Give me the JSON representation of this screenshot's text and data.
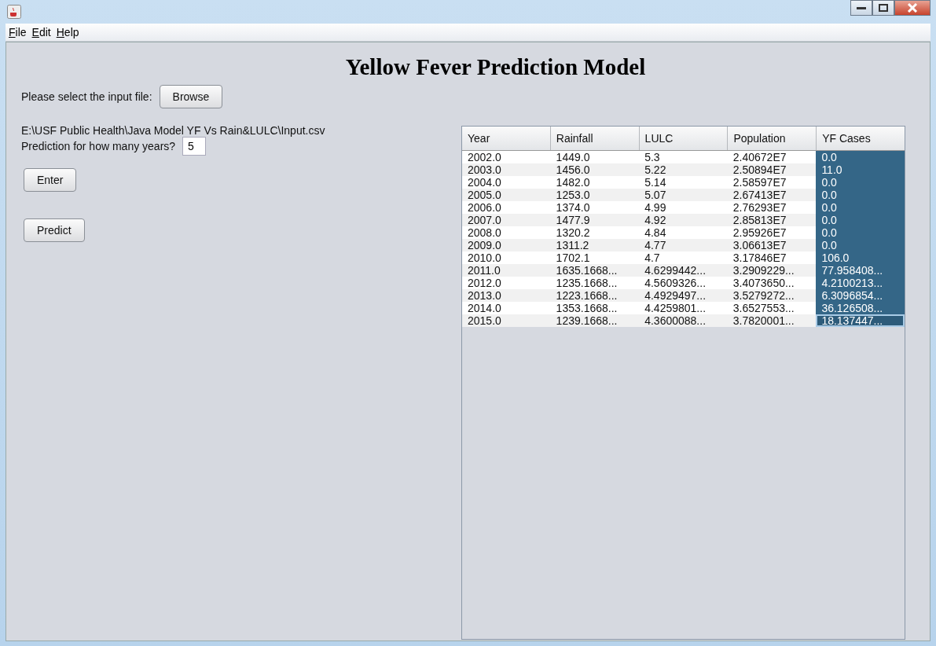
{
  "menu": [
    "File",
    "Edit",
    "Help"
  ],
  "title": "Yellow Fever Prediction Model",
  "file_prompt": "Please select the input file:",
  "browse_button": "Browse",
  "file_path": "E:\\USF Public Health\\Java Model YF Vs Rain&LULC\\Input.csv",
  "years_prompt": "Prediction for how many years?",
  "years_field": {
    "value": "5"
  },
  "buttons": [
    "Enter",
    "Predict"
  ],
  "table": {
    "columns": [
      {
        "label": "Year",
        "selected": false
      },
      {
        "label": "Rainfall",
        "selected": false
      },
      {
        "label": "LULC",
        "selected": false
      },
      {
        "label": "Population",
        "selected": false
      },
      {
        "label": "YF Cases",
        "selected": true
      }
    ],
    "rows": [
      {
        "cells": [
          "2002.0",
          "1449.0",
          "5.3",
          "2.40672E7",
          "0.0"
        ],
        "focused": false
      },
      {
        "cells": [
          "2003.0",
          "1456.0",
          "5.22",
          "2.50894E7",
          "11.0"
        ],
        "focused": false
      },
      {
        "cells": [
          "2004.0",
          "1482.0",
          "5.14",
          "2.58597E7",
          "0.0"
        ],
        "focused": false
      },
      {
        "cells": [
          "2005.0",
          "1253.0",
          "5.07",
          "2.67413E7",
          "0.0"
        ],
        "focused": false
      },
      {
        "cells": [
          "2006.0",
          "1374.0",
          "4.99",
          "2.76293E7",
          "0.0"
        ],
        "focused": false
      },
      {
        "cells": [
          "2007.0",
          "1477.9",
          "4.92",
          "2.85813E7",
          "0.0"
        ],
        "focused": false
      },
      {
        "cells": [
          "2008.0",
          "1320.2",
          "4.84",
          "2.95926E7",
          "0.0"
        ],
        "focused": false
      },
      {
        "cells": [
          "2009.0",
          "1311.2",
          "4.77",
          "3.06613E7",
          "0.0"
        ],
        "focused": false
      },
      {
        "cells": [
          "2010.0",
          "1702.1",
          "4.7",
          "3.17846E7",
          "106.0"
        ],
        "focused": false
      },
      {
        "cells": [
          "2011.0",
          "1635.1668...",
          "4.6299442...",
          "3.2909229...",
          "77.958408..."
        ],
        "focused": false
      },
      {
        "cells": [
          "2012.0",
          "1235.1668...",
          "4.5609326...",
          "3.4073650...",
          "4.2100213..."
        ],
        "focused": false
      },
      {
        "cells": [
          "2013.0",
          "1223.1668...",
          "4.4929497...",
          "3.5279272...",
          "6.3096854..."
        ],
        "focused": false
      },
      {
        "cells": [
          "2014.0",
          "1353.1668...",
          "4.4259801...",
          "3.6527553...",
          "36.126508..."
        ],
        "focused": false
      },
      {
        "cells": [
          "2015.0",
          "1239.1668...",
          "4.3600088...",
          "3.7820001...",
          "18.137447..."
        ],
        "focused": true
      }
    ]
  }
}
